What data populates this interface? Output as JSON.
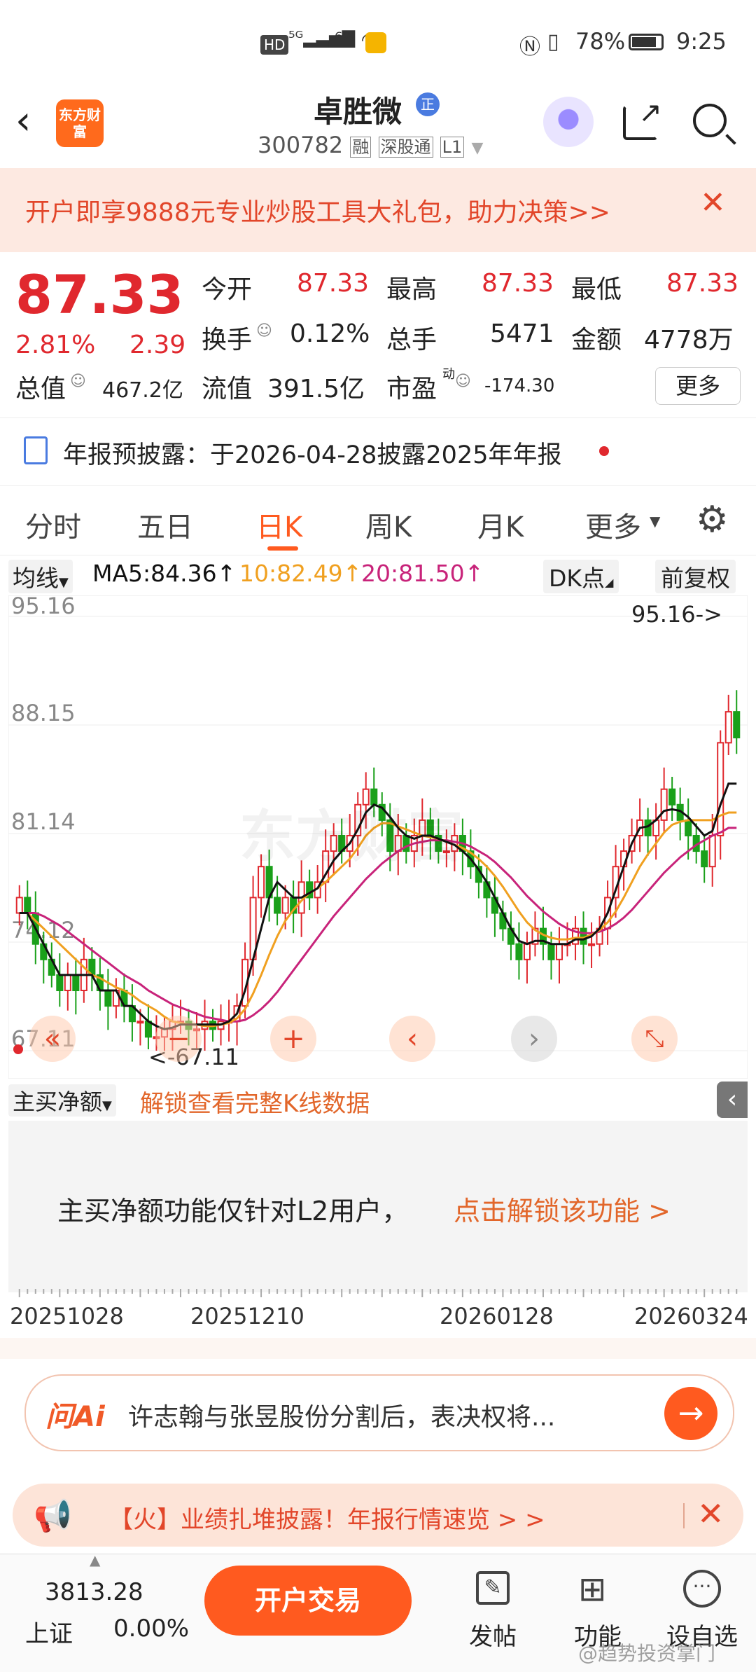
{
  "status": {
    "icons": [
      "hd-icon",
      "5g-signal-icon",
      "wifi-icon",
      "weibo-icon",
      "nfc-icon",
      "vibrate-icon",
      "battery-icon"
    ],
    "battery": "78%",
    "time": "9:25"
  },
  "header": {
    "logo_text": "东方财富",
    "stock_name": "卓胜微",
    "badge": "正",
    "code": "300782",
    "tag_rong": "融",
    "tag_sgt": "深股通",
    "tag_level": "L1"
  },
  "promo": {
    "text": "开户即享9888元专业炒股工具大礼包，助力决策>>"
  },
  "quote": {
    "price": "87.33",
    "change_pct": "2.81%",
    "change_amt": "2.39",
    "open_label": "今开",
    "open": "87.33",
    "high_label": "最高",
    "high": "87.33",
    "low_label": "最低",
    "low": "87.33",
    "turnover_label": "换手",
    "turnover": "0.12%",
    "volume_label": "总手",
    "volume": "5471",
    "amount_label": "金额",
    "amount": "4778万",
    "mcap_label": "总值",
    "mcap": "467.2亿",
    "float_label": "流值",
    "float_cap": "391.5亿",
    "pe_label": "市盈",
    "pe_sup": "动",
    "pe": "-174.30",
    "more_label": "更多"
  },
  "notice": {
    "text": "年报预披露：于2026-04-28披露2025年年报"
  },
  "tabs": [
    "分时",
    "五日",
    "日K",
    "周K",
    "月K",
    "更多"
  ],
  "active_tab": "日K",
  "mabar": {
    "selector": "均线",
    "ma5": "MA5:84.36↑",
    "ma10": "10:82.49↑",
    "ma20": "20:81.50↑",
    "dk": "DK点",
    "restore": "前复权"
  },
  "chart_data": {
    "type": "candlestick",
    "y_ticks": [
      "95.16",
      "88.15",
      "81.14",
      "74.12",
      "67.11"
    ],
    "ylim": [
      67.11,
      95.16
    ],
    "max_label": "95.16->",
    "min_label": "<-67.11",
    "x_ticks": [
      "20251028",
      "20251210",
      "20260128",
      "20260324"
    ],
    "closes": [
      77,
      76,
      74,
      73,
      72,
      71,
      72,
      71,
      73,
      72,
      71,
      70,
      71,
      70,
      69,
      69,
      68,
      68,
      68.5,
      69,
      69,
      68.5,
      68.5,
      69,
      68.5,
      69,
      69,
      70,
      73,
      77,
      79,
      77,
      76,
      77,
      76,
      78,
      77,
      78,
      80,
      81,
      80,
      81,
      83,
      84,
      83,
      82,
      80,
      81,
      80,
      81,
      82,
      81,
      80,
      80,
      81,
      80,
      79,
      78,
      77,
      76,
      75,
      74,
      73,
      74,
      75,
      74,
      73,
      74,
      74,
      75,
      74,
      74,
      75,
      77,
      79,
      80,
      81,
      82,
      81,
      82,
      84,
      83,
      82,
      81,
      80,
      79,
      81,
      87,
      89,
      87.33
    ],
    "ma5": [
      76,
      76,
      75,
      74,
      73,
      72,
      72,
      72,
      72,
      72,
      71,
      71,
      71,
      70,
      70,
      69.5,
      69,
      68.7,
      68.5,
      68.6,
      68.8,
      68.8,
      68.8,
      68.8,
      68.8,
      68.8,
      69,
      69.5,
      71,
      73,
      75,
      77,
      78,
      77.5,
      77,
      77,
      77.3,
      77.6,
      78.5,
      79.4,
      80,
      80.5,
      81.4,
      82.5,
      83,
      82.8,
      82.2,
      81.5,
      81,
      80.8,
      81,
      81,
      80.8,
      80.6,
      80.4,
      80,
      79.5,
      78.8,
      78,
      77,
      76,
      75,
      74.2,
      74,
      74.2,
      74.2,
      74,
      74,
      74,
      74.3,
      74.3,
      74.5,
      75,
      76,
      77.5,
      79,
      80.5,
      81.5,
      81.6,
      82,
      82.6,
      82.7,
      82.6,
      82.2,
      81.6,
      81,
      81.3,
      83,
      84.36,
      84.36
    ],
    "ma10": [
      76,
      76,
      75.5,
      75,
      74.5,
      74,
      73.5,
      73,
      72.5,
      72,
      71.8,
      71.5,
      71.2,
      71,
      70.7,
      70.3,
      70,
      69.7,
      69.3,
      69,
      68.9,
      68.8,
      68.8,
      68.7,
      68.7,
      68.8,
      68.9,
      69.2,
      69.8,
      70.8,
      72,
      73.3,
      74.5,
      75.5,
      76.2,
      76.8,
      77.3,
      77.6,
      78,
      78.5,
      79,
      79.5,
      80.2,
      81,
      81.5,
      81.8,
      81.8,
      81.6,
      81.4,
      81.2,
      81,
      80.9,
      80.8,
      80.6,
      80.4,
      80.2,
      79.9,
      79.5,
      79,
      78.4,
      77.7,
      76.9,
      76.1,
      75.4,
      74.9,
      74.6,
      74.4,
      74.3,
      74.3,
      74.4,
      74.4,
      74.6,
      74.9,
      75.4,
      76.1,
      77,
      78,
      79,
      79.8,
      80.5,
      81.2,
      81.7,
      81.9,
      82,
      82,
      82,
      82,
      82.3,
      82.49,
      82.49
    ],
    "ma20": [
      76,
      76,
      76,
      75.8,
      75.5,
      75.2,
      74.8,
      74.4,
      74,
      73.6,
      73.2,
      72.8,
      72.4,
      72,
      71.7,
      71.4,
      71,
      70.7,
      70.4,
      70.1,
      69.9,
      69.7,
      69.5,
      69.3,
      69.2,
      69.1,
      69,
      69,
      69.1,
      69.4,
      69.8,
      70.3,
      70.9,
      71.6,
      72.3,
      73,
      73.7,
      74.4,
      75.1,
      75.8,
      76.4,
      77,
      77.6,
      78.2,
      78.7,
      79.2,
      79.6,
      80,
      80.3,
      80.5,
      80.6,
      80.7,
      80.7,
      80.7,
      80.6,
      80.5,
      80.3,
      80,
      79.7,
      79.3,
      78.8,
      78.3,
      77.7,
      77.1,
      76.6,
      76.1,
      75.7,
      75.3,
      75,
      74.8,
      74.7,
      74.7,
      74.8,
      75,
      75.3,
      75.7,
      76.2,
      76.8,
      77.4,
      78,
      78.6,
      79.1,
      79.6,
      80,
      80.4,
      80.7,
      81,
      81.2,
      81.5,
      81.5
    ]
  },
  "chart_controls": [
    "double-left-icon",
    "minus-icon",
    "plus-icon",
    "left-icon",
    "right-icon",
    "expand-icon"
  ],
  "watermark": "东方财富",
  "subbar": {
    "selector": "主买净额",
    "unlock": "解锁查看完整K线数据"
  },
  "lock": {
    "text": "主买净额功能仅针对L2用户，",
    "link": "点击解锁该功能 >"
  },
  "ai": {
    "brand": "问Ai",
    "text": "许志翰与张昱股份分割后，表决权将..."
  },
  "hot": {
    "text": "【火】业绩扎堆披露！年报行情速览 > >"
  },
  "bottom": {
    "index_value": "3813.28",
    "index_name": "上证",
    "index_change": "0.00%",
    "trade": "开户交易",
    "post": "发帖",
    "func": "功能",
    "watch": "设自选",
    "credit": "@趋势投资掌门"
  },
  "colors": {
    "up": "#e0282e",
    "down": "#1aa01a",
    "ma5": "#111111",
    "ma10": "#f0a020",
    "ma20": "#c8237a",
    "accent": "#ff5a1f"
  }
}
